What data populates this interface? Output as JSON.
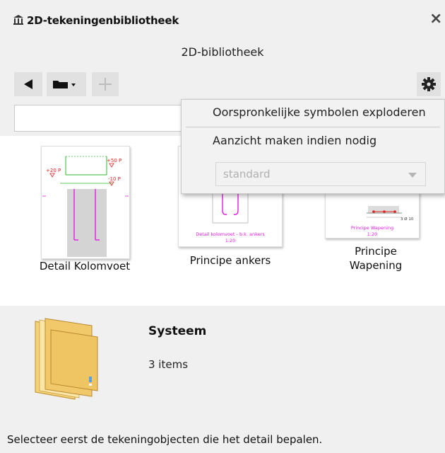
{
  "window": {
    "title": "2D-tekeningenbibliotheek",
    "icon": "library-icon",
    "close_label": "×"
  },
  "library": {
    "subtitle": "2D-bibliotheek"
  },
  "toolbar": {
    "back_icon": "triangle-left-icon",
    "folder_icon": "folder-dropdown-icon",
    "add_icon": "plus-icon",
    "settings_icon": "gear-icon"
  },
  "search": {
    "value": "",
    "placeholder": ""
  },
  "items": [
    {
      "label": "Detail Kolomvoet",
      "drawing": {
        "level_top": "+50 P",
        "level_left": "+20 P",
        "level_bottom": "-10 P"
      }
    },
    {
      "label": "Principe ankers",
      "drawing": {
        "caption": "Detail kolomvoet - b.k. ankers",
        "scale": "1:20"
      }
    },
    {
      "label": "Principe Wapening",
      "drawing": {
        "caption": "Principe Wapening",
        "scale": "1:20",
        "dim": "3 Ø 10"
      }
    }
  ],
  "settings_menu": {
    "items": [
      "Oorspronkelijke symbolen exploderen",
      "Aanzicht maken indien nodig"
    ],
    "select_value": "standard"
  },
  "selection": {
    "name": "Systeem",
    "count": "3 items"
  },
  "status": {
    "text": "Selecteer eerst de tekeningobjecten die het detail bepalen."
  },
  "colors": {
    "drawing_green": "#2db82d",
    "drawing_magenta": "#e619e6",
    "drawing_red": "#e02020",
    "folder_yellow": "#f2c96a"
  }
}
